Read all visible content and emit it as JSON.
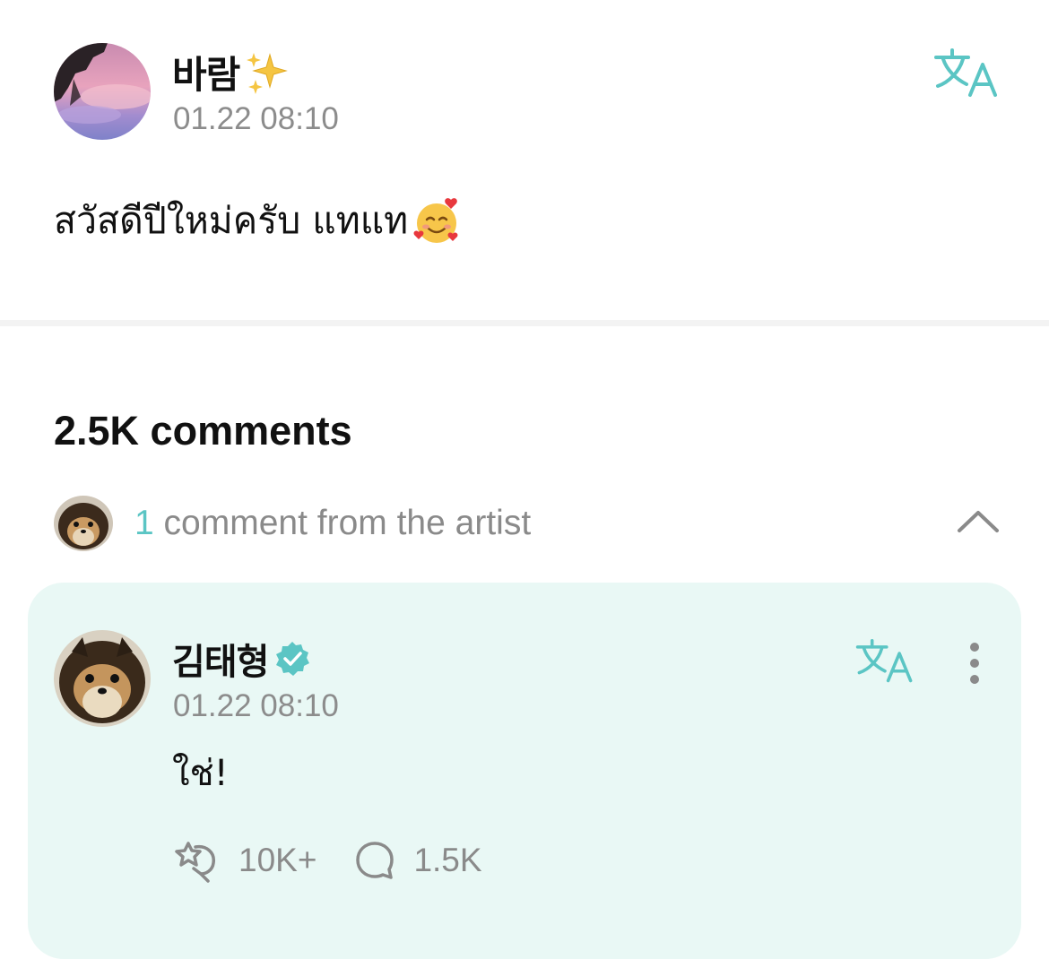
{
  "post": {
    "author": "바람",
    "author_emoji": "sparkles",
    "timestamp": "01.22 08:10",
    "text": "สวัสดีปีใหม่ครับ แทแท",
    "text_emoji": "smiling-face-with-hearts",
    "translate_icon": "translate-icon"
  },
  "comments": {
    "count_label": "2.5K comments",
    "artist_row": {
      "count": "1",
      "label": "comment from the artist",
      "chevron": "chevron-up-icon"
    }
  },
  "artist_comment": {
    "name": "김태형",
    "verified": true,
    "timestamp": "01.22 08:10",
    "text": "ใช่!",
    "likes": "10K+",
    "replies": "1.5K"
  },
  "colors": {
    "accent": "#5bc5c4",
    "card_bg": "#e9f8f5",
    "muted_text": "#8c8c8c",
    "divider": "#f3f3f3"
  }
}
